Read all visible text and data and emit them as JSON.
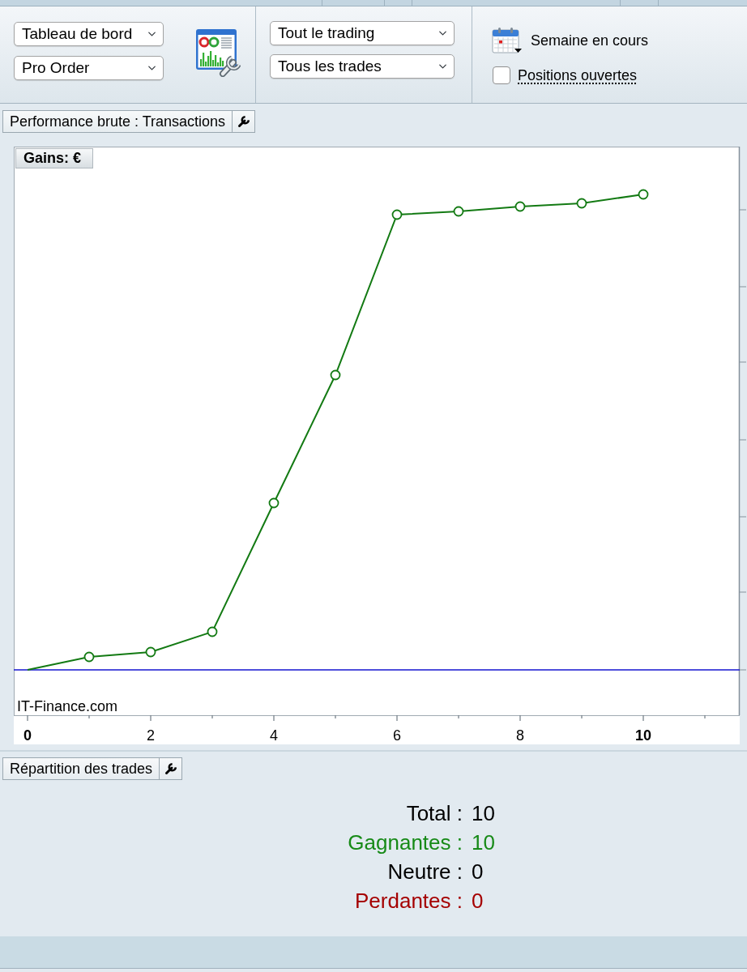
{
  "toolbar": {
    "selects_left": [
      {
        "value": "Tableau de bord"
      },
      {
        "value": "Pro Order"
      }
    ],
    "selects_middle": [
      {
        "value": "Tout le trading"
      },
      {
        "value": "Tous les trades"
      }
    ],
    "period": {
      "label": "Semaine en cours"
    },
    "open_positions": {
      "label": "Positions ouvertes",
      "checked": false
    }
  },
  "performance_panel": {
    "header": {
      "label": "Performance brute : Transactions"
    },
    "chart": {
      "y_label": "Gains: €",
      "credit": "IT-Finance.com",
      "x_tick_labels": [
        "0",
        "2",
        "4",
        "6",
        "8",
        "10"
      ]
    }
  },
  "distribution_panel": {
    "header": {
      "label": "Répartition des trades"
    },
    "stats": [
      {
        "label": "Total :",
        "value": "10",
        "color": "#000000"
      },
      {
        "label": "Gagnantes :",
        "value": "10",
        "color": "#178a17"
      },
      {
        "label": "Neutre :",
        "value": "0",
        "color": "#000000"
      },
      {
        "label": "Perdantes :",
        "value": "0",
        "color": "#a50000"
      }
    ]
  }
}
